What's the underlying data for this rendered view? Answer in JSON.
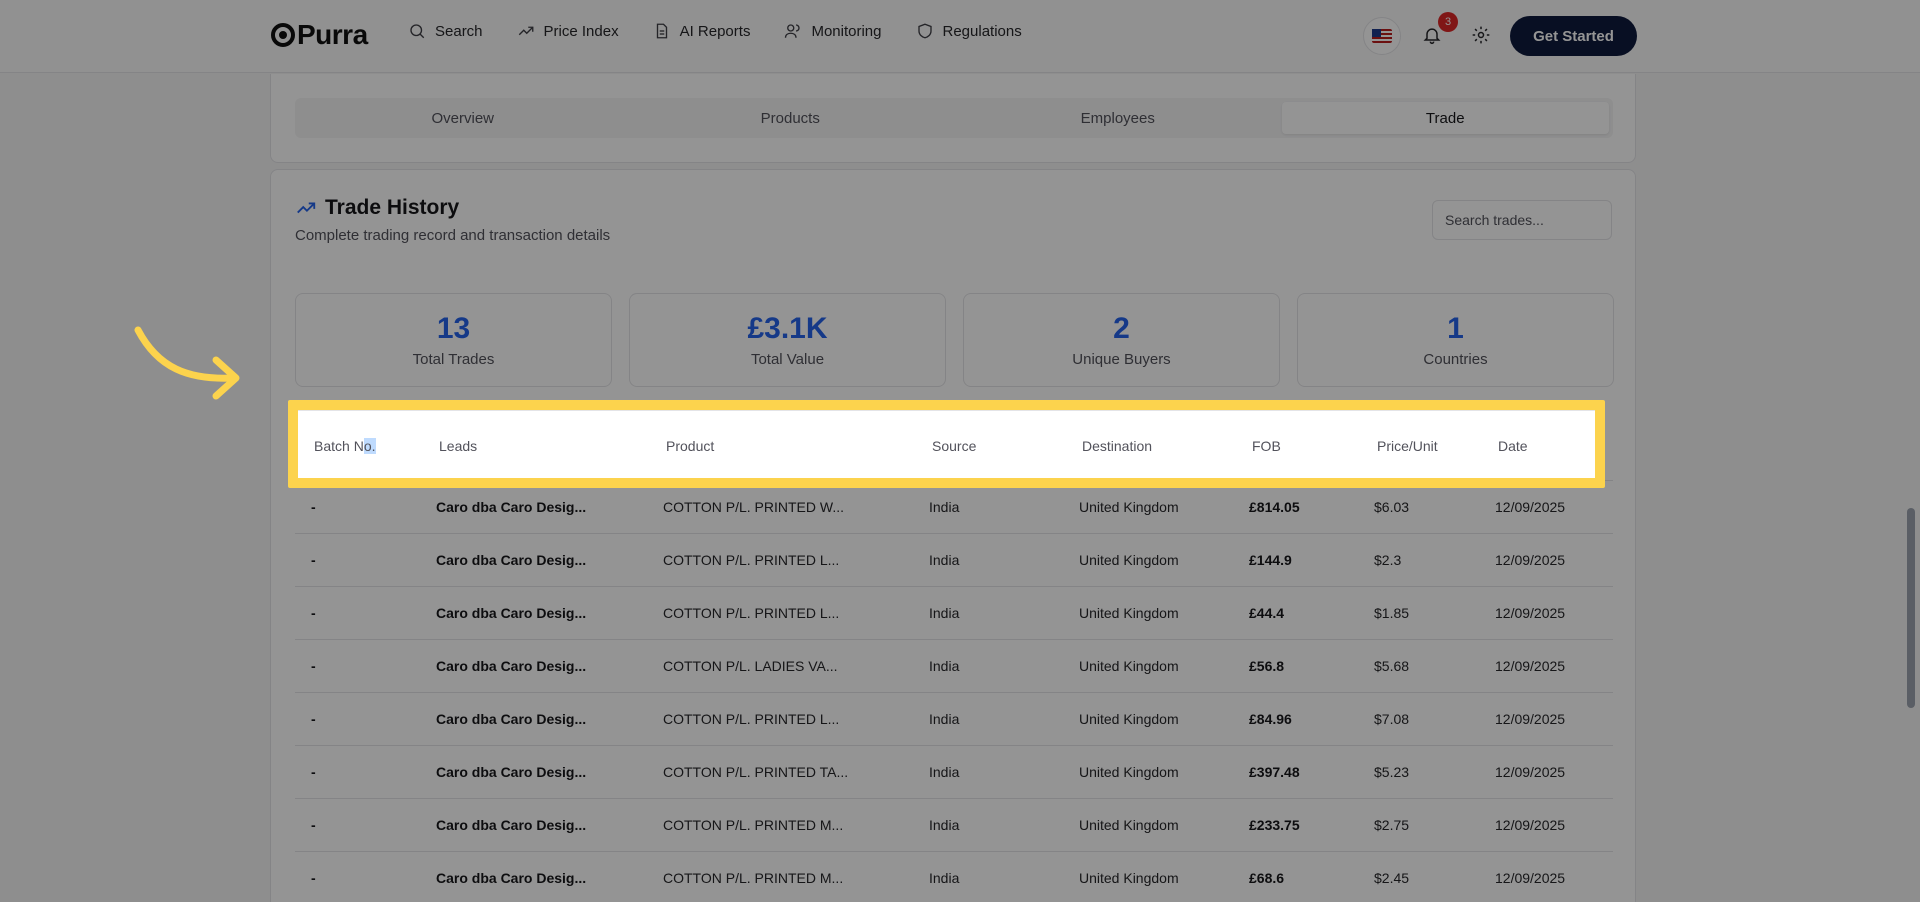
{
  "nav": {
    "logo": "Purra",
    "items": [
      {
        "label": "Search",
        "icon": "search-icon"
      },
      {
        "label": "Price Index",
        "icon": "trending-up-icon"
      },
      {
        "label": "AI Reports",
        "icon": "document-icon"
      },
      {
        "label": "Monitoring",
        "icon": "users-icon"
      },
      {
        "label": "Regulations",
        "icon": "shield-icon"
      }
    ],
    "notification_count": "3",
    "cta_label": "Get Started"
  },
  "tabs": [
    "Overview",
    "Products",
    "Employees",
    "Trade"
  ],
  "active_tab": "Trade",
  "trade": {
    "title": "Trade History",
    "subtitle": "Complete trading record and transaction details",
    "search_placeholder": "Search trades...",
    "stats": [
      {
        "value": "13",
        "label": "Total Trades"
      },
      {
        "value": "£3.1K",
        "label": "Total Value"
      },
      {
        "value": "2",
        "label": "Unique Buyers"
      },
      {
        "value": "1",
        "label": "Countries"
      }
    ],
    "columns": [
      "Batch No.",
      "Leads",
      "Product",
      "Source",
      "Destination",
      "FOB",
      "Price/Unit",
      "Date"
    ],
    "rows": [
      [
        "-",
        "Caro dba Caro Desig...",
        "COTTON P/L. PRINTED W...",
        "India",
        "United Kingdom",
        "£814.05",
        "$6.03",
        "12/09/2025"
      ],
      [
        "-",
        "Caro dba Caro Desig...",
        "COTTON P/L. PRINTED L...",
        "India",
        "United Kingdom",
        "£144.9",
        "$2.3",
        "12/09/2025"
      ],
      [
        "-",
        "Caro dba Caro Desig...",
        "COTTON P/L. PRINTED L...",
        "India",
        "United Kingdom",
        "£44.4",
        "$1.85",
        "12/09/2025"
      ],
      [
        "-",
        "Caro dba Caro Desig...",
        "COTTON P/L. LADIES VA...",
        "India",
        "United Kingdom",
        "£56.8",
        "$5.68",
        "12/09/2025"
      ],
      [
        "-",
        "Caro dba Caro Desig...",
        "COTTON P/L. PRINTED L...",
        "India",
        "United Kingdom",
        "£84.96",
        "$7.08",
        "12/09/2025"
      ],
      [
        "-",
        "Caro dba Caro Desig...",
        "COTTON P/L. PRINTED TA...",
        "India",
        "United Kingdom",
        "£397.48",
        "$5.23",
        "12/09/2025"
      ],
      [
        "-",
        "Caro dba Caro Desig...",
        "COTTON P/L. PRINTED M...",
        "India",
        "United Kingdom",
        "£233.75",
        "$2.75",
        "12/09/2025"
      ],
      [
        "-",
        "Caro dba Caro Desig...",
        "COTTON P/L. PRINTED M...",
        "India",
        "United Kingdom",
        "£68.6",
        "$2.45",
        "12/09/2025"
      ]
    ]
  },
  "colors": {
    "accent": "#2563eb",
    "highlight": "#fcd34d",
    "cta": "#0f1a3d",
    "badge": "#dc2626"
  }
}
